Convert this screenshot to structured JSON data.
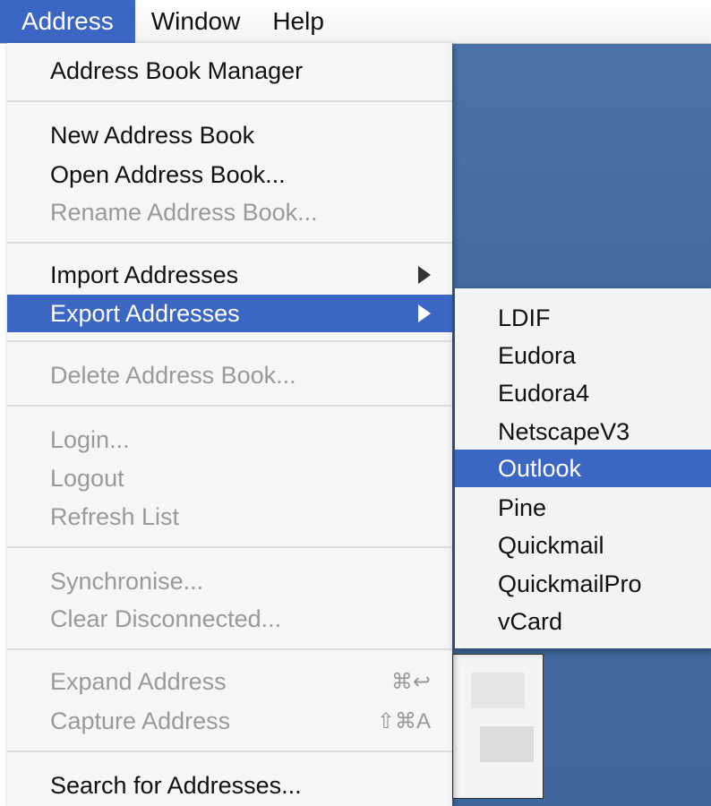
{
  "menubar": {
    "items": [
      {
        "label": "Address",
        "active": true
      },
      {
        "label": "Window",
        "active": false
      },
      {
        "label": "Help",
        "active": false
      }
    ]
  },
  "address_menu": {
    "address_book_manager": "Address Book Manager",
    "new_address_book": "New Address Book",
    "open_address_book": "Open Address Book...",
    "rename_address_book": "Rename Address Book...",
    "import_addresses": "Import Addresses",
    "export_addresses": "Export Addresses",
    "delete_address_book": "Delete Address Book...",
    "login": "Login...",
    "logout": "Logout",
    "refresh_list": "Refresh List",
    "synchronise": "Synchronise...",
    "clear_disconnected": "Clear Disconnected...",
    "expand_address": "Expand Address",
    "expand_address_shortcut": "⌘↩",
    "capture_address": "Capture Address",
    "capture_address_shortcut": "⇧⌘A",
    "search_for_addresses": "Search for Addresses..."
  },
  "export_submenu": {
    "items": [
      "LDIF",
      "Eudora",
      "Eudora4",
      "NetscapeV3",
      "Outlook",
      "Pine",
      "Quickmail",
      "QuickmailPro",
      "vCard"
    ],
    "highlighted": "Outlook"
  },
  "colors": {
    "highlight": "#3c66c4",
    "disabled_text": "#9a9a9a",
    "desktop_blue": "#4b73a8"
  },
  "icons": {
    "submenu_arrow": "right-triangle-icon"
  }
}
